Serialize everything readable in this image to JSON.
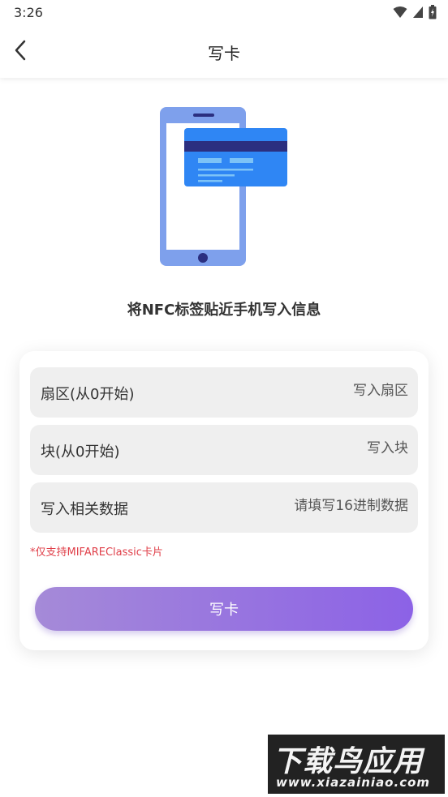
{
  "status_bar": {
    "time": "3:26",
    "icons": [
      "wifi-icon",
      "signal-icon",
      "battery-icon"
    ]
  },
  "header": {
    "title": "写卡",
    "back_icon": "chevron-left-icon"
  },
  "illustration": {
    "name": "phone-nfc-card-illustration",
    "colors": {
      "phone": "#7ea0ec",
      "card": "#2f86f4",
      "card_stripe": "#2b2f80"
    }
  },
  "instruction": "将NFC标签贴近手机写入信息",
  "form": {
    "fields": [
      {
        "label": "扇区(从0开始)",
        "placeholder": "写入扇区",
        "value": ""
      },
      {
        "label": "块(从0开始)",
        "placeholder": "写入块",
        "value": ""
      },
      {
        "label": "写入相关数据",
        "placeholder": "请填写16进制数据",
        "value": ""
      }
    ],
    "note": "*仅支持MIFAREClassic卡片",
    "submit_label": "写卡"
  },
  "colors": {
    "button_gradient_start": "#a58ad8",
    "button_gradient_end": "#8c62e6",
    "note": "#e0404a",
    "field_background": "#efefef"
  },
  "watermark": {
    "title": "下载鸟应用",
    "url": "www.xiazainiao.com"
  }
}
